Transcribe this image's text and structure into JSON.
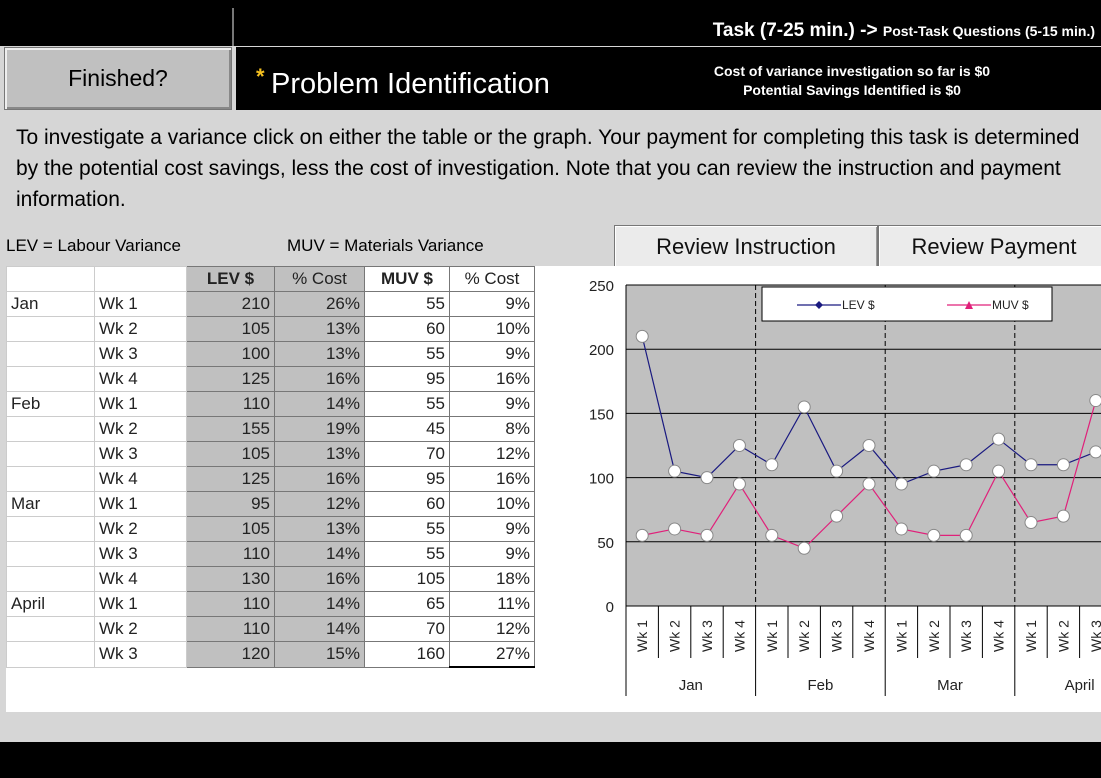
{
  "header": {
    "task_label": "Task (7-25 min.)",
    "arrow": " -> ",
    "post_task_label": "Post-Task Questions (5-15 min.)",
    "finished_button": "Finished?",
    "star": "*",
    "title": "Problem Identification",
    "cost_info": "Cost of variance investigation so far is $0",
    "savings_info": "Potential Savings Identified is $0"
  },
  "instructions": "To investigate a variance click on either the table or the graph. Your payment for completing this task is determined by the potential cost savings, less the cost of investigation. Note that you can review the instruction and payment information.",
  "legend": {
    "lev": "LEV = Labour Variance",
    "muv": "MUV = Materials Variance"
  },
  "buttons": {
    "review_instruction": "Review Instruction",
    "review_payment": "Review Payment"
  },
  "table": {
    "headers": [
      "",
      "",
      "LEV $",
      "% Cost",
      "MUV $",
      "% Cost"
    ],
    "rows": [
      {
        "month": "Jan",
        "week": "Wk 1",
        "lev": "210",
        "lev_pct": "26%",
        "muv": "55",
        "muv_pct": "9%"
      },
      {
        "month": "",
        "week": "Wk 2",
        "lev": "105",
        "lev_pct": "13%",
        "muv": "60",
        "muv_pct": "10%"
      },
      {
        "month": "",
        "week": "Wk 3",
        "lev": "100",
        "lev_pct": "13%",
        "muv": "55",
        "muv_pct": "9%"
      },
      {
        "month": "",
        "week": "Wk 4",
        "lev": "125",
        "lev_pct": "16%",
        "muv": "95",
        "muv_pct": "16%"
      },
      {
        "month": "Feb",
        "week": "Wk 1",
        "lev": "110",
        "lev_pct": "14%",
        "muv": "55",
        "muv_pct": "9%"
      },
      {
        "month": "",
        "week": "Wk 2",
        "lev": "155",
        "lev_pct": "19%",
        "muv": "45",
        "muv_pct": "8%"
      },
      {
        "month": "",
        "week": "Wk 3",
        "lev": "105",
        "lev_pct": "13%",
        "muv": "70",
        "muv_pct": "12%"
      },
      {
        "month": "",
        "week": "Wk 4",
        "lev": "125",
        "lev_pct": "16%",
        "muv": "95",
        "muv_pct": "16%"
      },
      {
        "month": "Mar",
        "week": "Wk 1",
        "lev": "95",
        "lev_pct": "12%",
        "muv": "60",
        "muv_pct": "10%"
      },
      {
        "month": "",
        "week": "Wk 2",
        "lev": "105",
        "lev_pct": "13%",
        "muv": "55",
        "muv_pct": "9%"
      },
      {
        "month": "",
        "week": "Wk 3",
        "lev": "110",
        "lev_pct": "14%",
        "muv": "55",
        "muv_pct": "9%"
      },
      {
        "month": "",
        "week": "Wk 4",
        "lev": "130",
        "lev_pct": "16%",
        "muv": "105",
        "muv_pct": "18%"
      },
      {
        "month": "April",
        "week": "Wk 1",
        "lev": "110",
        "lev_pct": "14%",
        "muv": "65",
        "muv_pct": "11%"
      },
      {
        "month": "",
        "week": "Wk 2",
        "lev": "110",
        "lev_pct": "14%",
        "muv": "70",
        "muv_pct": "12%"
      },
      {
        "month": "",
        "week": "Wk 3",
        "lev": "120",
        "lev_pct": "15%",
        "muv": "160",
        "muv_pct": "27%"
      }
    ]
  },
  "chart_data": {
    "type": "line",
    "categories": [
      "Wk 1",
      "Wk 2",
      "Wk 3",
      "Wk 4",
      "Wk 1",
      "Wk 2",
      "Wk 3",
      "Wk 4",
      "Wk 1",
      "Wk 2",
      "Wk 3",
      "Wk 4",
      "Wk 1",
      "Wk 2",
      "Wk 3"
    ],
    "groups": [
      "Jan",
      "Feb",
      "Mar",
      "April"
    ],
    "series": [
      {
        "name": "LEV $",
        "color": "#1a1a80",
        "marker": "diamond",
        "values": [
          210,
          105,
          100,
          125,
          110,
          155,
          105,
          125,
          95,
          105,
          110,
          130,
          110,
          110,
          120
        ]
      },
      {
        "name": "MUV $",
        "color": "#e0207a",
        "marker": "triangle",
        "values": [
          55,
          60,
          55,
          95,
          55,
          45,
          70,
          95,
          60,
          55,
          55,
          105,
          65,
          70,
          160
        ]
      }
    ],
    "yticks": [
      "250",
      "200",
      "150",
      "100",
      "50",
      "0"
    ],
    "ylim": [
      0,
      250
    ],
    "grid": true,
    "legend_position": "top",
    "title": "",
    "xlabel": "",
    "ylabel": ""
  }
}
